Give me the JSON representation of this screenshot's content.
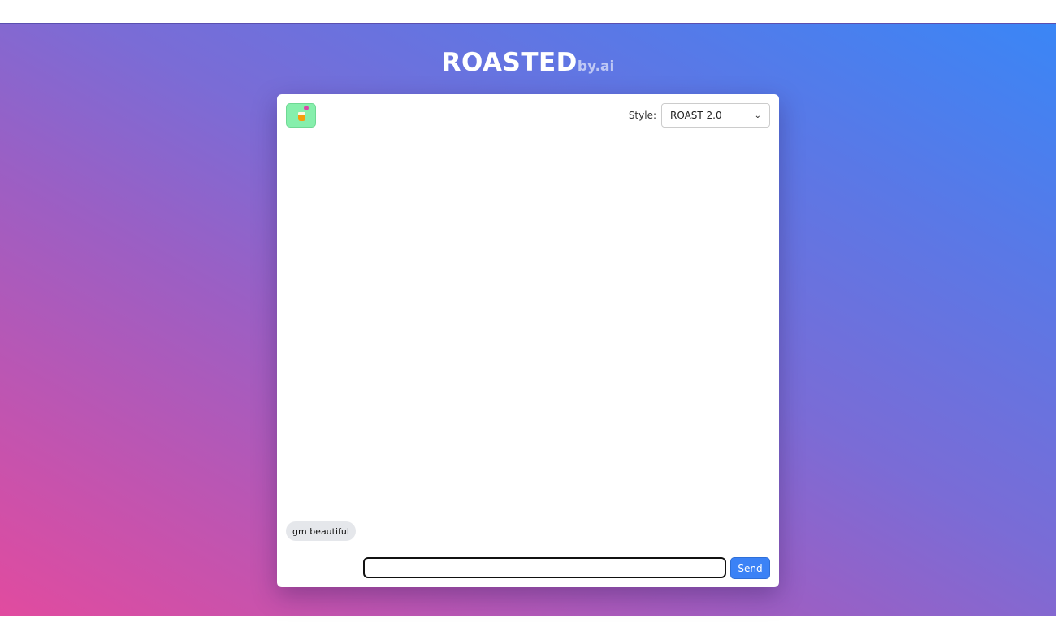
{
  "brand": {
    "title": "ROASTED",
    "suffix": "by.ai"
  },
  "mascot": {
    "icon": "coffee-cup-icon"
  },
  "style_selector": {
    "label": "Style:",
    "selected": "ROAST 2.0"
  },
  "messages": [
    {
      "text": "gm beautiful"
    }
  ],
  "composer": {
    "value": "",
    "send_label": "Send"
  },
  "colors": {
    "accent": "#3b82f6",
    "mascot_bg": "#86efac",
    "bubble_bg": "#e5e7eb"
  }
}
